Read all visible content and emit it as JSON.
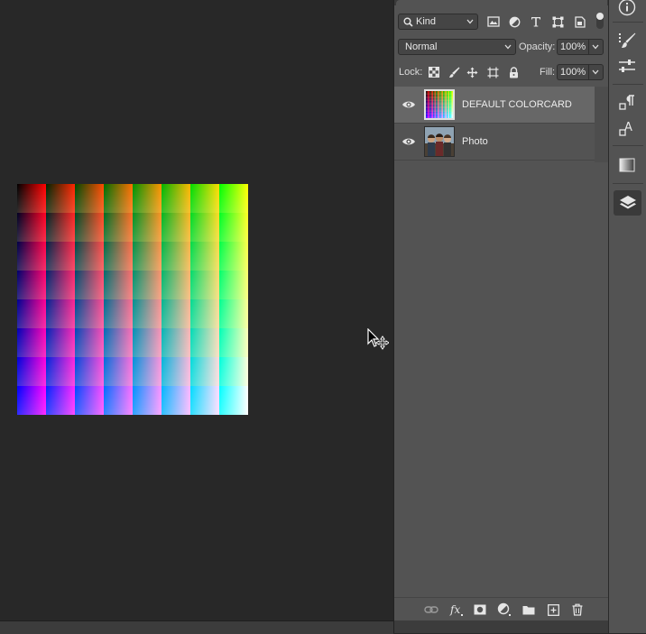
{
  "canvas": {
    "colorcard_alt": ""
  },
  "layers_panel": {
    "filter": {
      "kind_label": "Kind",
      "icons": [
        "search-icon",
        "image-filter-icon",
        "adjustment-filter-icon",
        "type-filter-icon",
        "shape-filter-icon",
        "smart-object-filter-icon"
      ]
    },
    "blend_mode": "Normal",
    "opacity_label": "Opacity:",
    "opacity_value": "100%",
    "lock_label": "Lock:",
    "fill_label": "Fill:",
    "fill_value": "100%",
    "layers": [
      {
        "name": "DEFAULT COLORCARD",
        "visible": true,
        "selected": true
      },
      {
        "name": "Photo",
        "visible": true,
        "selected": false
      }
    ],
    "footer_icons": [
      "link-icon",
      "fx-icon",
      "mask-icon",
      "adjustment-layer-icon",
      "group-folder-icon",
      "new-layer-icon",
      "trash-icon"
    ]
  },
  "right_dock": {
    "icons": [
      "info-icon",
      "brush-settings-icon",
      "properties-sliders-icon",
      "paragraph-icon",
      "character-icon",
      "gradient-icon",
      "layers-icon"
    ],
    "active": "layers-icon"
  },
  "colors": {
    "canvas_bg": "#282828",
    "panel_bg": "#535353",
    "selected_row": "#676767"
  }
}
